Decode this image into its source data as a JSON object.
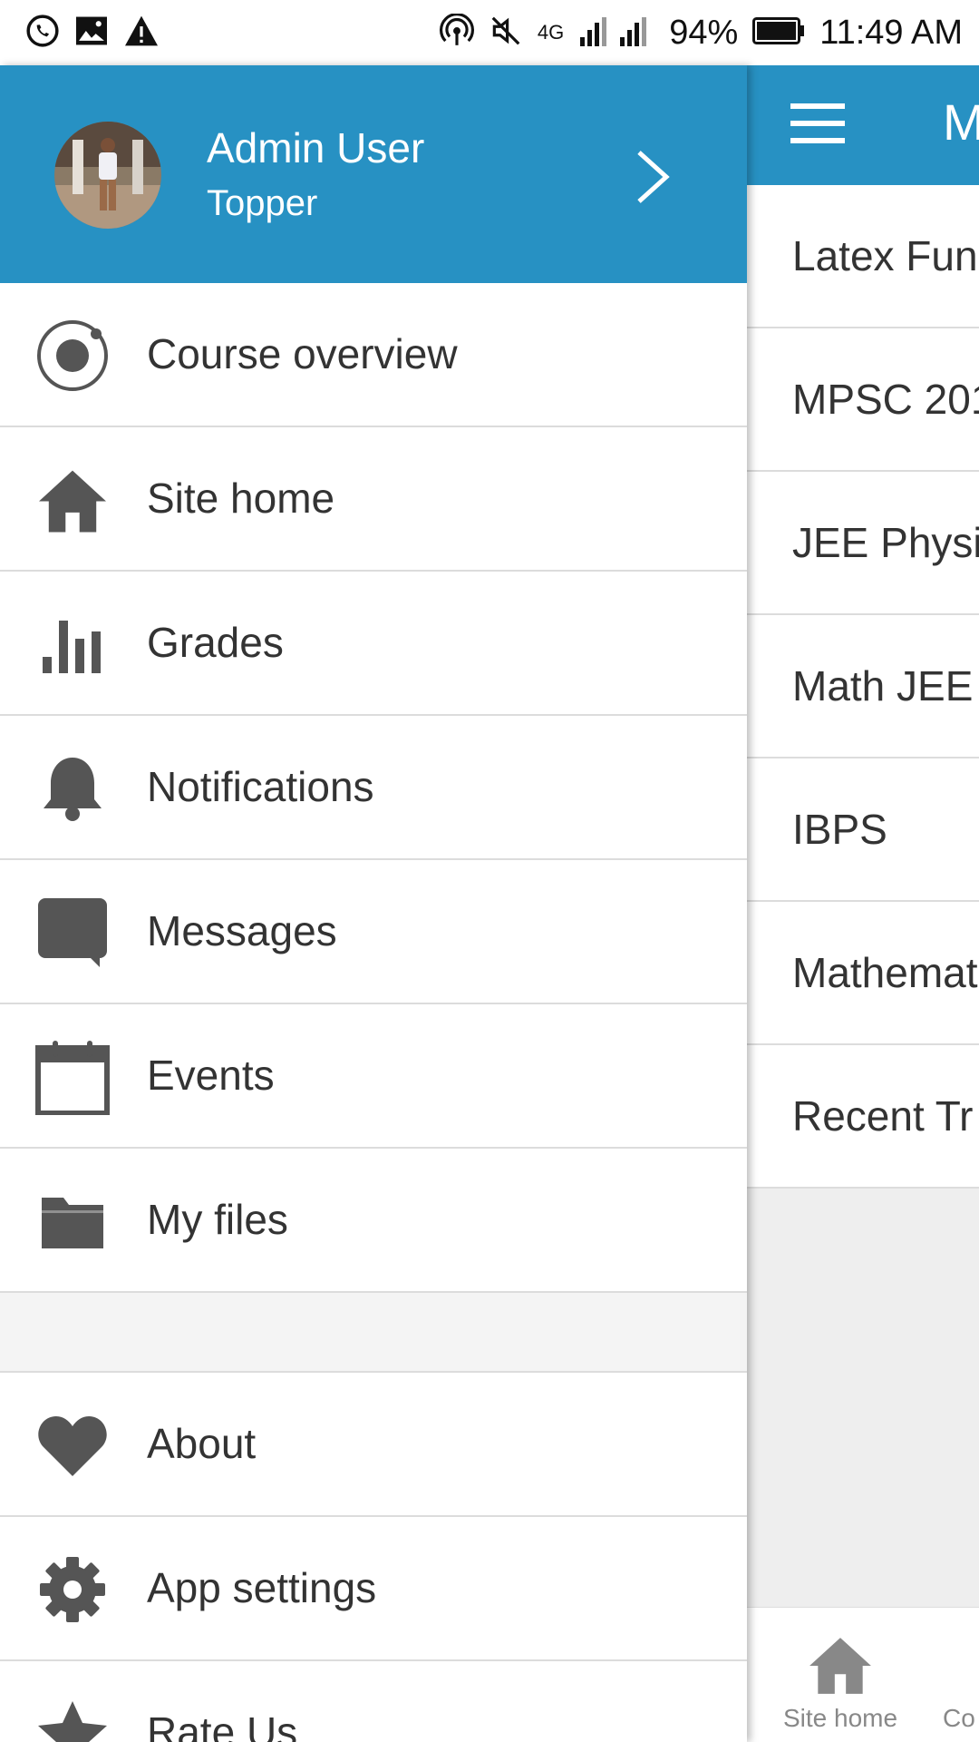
{
  "status_bar": {
    "network": "4G",
    "battery": "94%",
    "time": "11:49 AM",
    "left_icons": [
      "whatsapp-icon",
      "image-icon",
      "warning-icon"
    ],
    "right_icons": [
      "hotspot-icon",
      "mute-icon",
      "signal-icon",
      "battery-icon"
    ]
  },
  "drawer": {
    "user": {
      "name": "Admin User",
      "role": "Topper"
    },
    "items": [
      {
        "label": "Course overview",
        "icon": "course-overview-icon"
      },
      {
        "label": "Site home",
        "icon": "home-icon"
      },
      {
        "label": "Grades",
        "icon": "grades-icon"
      },
      {
        "label": "Notifications",
        "icon": "bell-icon"
      },
      {
        "label": "Messages",
        "icon": "message-icon"
      },
      {
        "label": "Events",
        "icon": "calendar-icon"
      },
      {
        "label": "My files",
        "icon": "folder-icon"
      }
    ],
    "items2": [
      {
        "label": "About",
        "icon": "heart-icon"
      },
      {
        "label": "App settings",
        "icon": "gear-icon"
      },
      {
        "label": "Rate Us",
        "icon": "star-icon"
      }
    ]
  },
  "background": {
    "toolbar_title": "M",
    "courses": [
      "Latex Fun",
      "MPSC 201",
      "JEE Physi",
      "Math JEE",
      "IBPS",
      "Mathemat",
      "Recent Tr"
    ],
    "tabs": [
      {
        "label": "Site home",
        "icon": "home-icon"
      },
      {
        "label": "Co",
        "icon": ""
      }
    ]
  },
  "colors": {
    "primary": "#2791c3",
    "icon_gray": "#555555",
    "divider": "#dcdcdc"
  }
}
